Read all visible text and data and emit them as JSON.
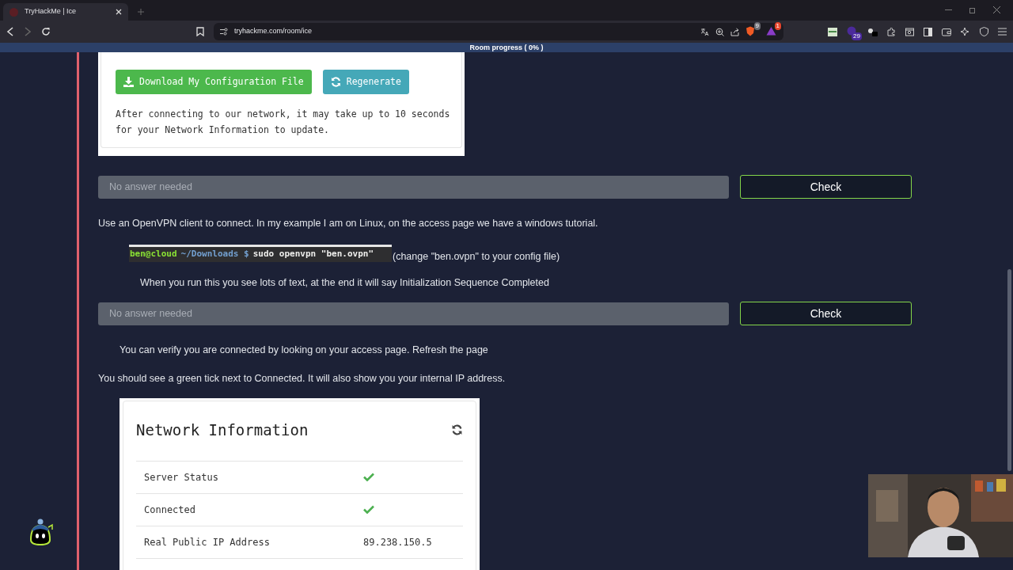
{
  "browser": {
    "tab_title": "TryHackMe | Ice",
    "url": "tryhackme.com/room/ice",
    "badges": [
      {
        "kind": "shield",
        "text": "9"
      },
      {
        "kind": "triangle",
        "text": "1"
      },
      {
        "kind": "extension",
        "text": "29"
      }
    ]
  },
  "progress_banner": "Room progress ( 0% )",
  "config_card": {
    "buttons": [
      {
        "kind": "download",
        "label": "Download My Configuration File"
      },
      {
        "kind": "regenerate",
        "label": "Regenerate"
      }
    ],
    "note": "After connecting to our network, it may take up to 10 seconds for your Network Information to update."
  },
  "blocks": [
    {
      "kind": "answer",
      "placeholder": "No answer needed",
      "button": "Check"
    },
    {
      "kind": "paragraph",
      "indented": false,
      "text": "Use an OpenVPN client to connect. In my example I am on Linux, on the access page we have a windows tutorial."
    },
    {
      "kind": "command",
      "user": "ben@cloud",
      "path": "~/Downloads $",
      "command": "sudo openvpn \"ben.ovpn\"",
      "note": "(change \"ben.ovpn\" to your config file)"
    },
    {
      "kind": "paragraph",
      "indented": true,
      "text": "When you run this you see lots of text, at the end it will say Initialization Sequence Completed"
    },
    {
      "kind": "answer",
      "placeholder": "No answer needed",
      "button": "Check"
    },
    {
      "kind": "paragraph",
      "indented": true,
      "text": "You can verify you are connected by looking on your access page. Refresh the page"
    },
    {
      "kind": "paragraph",
      "indented": false,
      "text": "You should see a green tick next to Connected. It will also show you your internal IP address."
    },
    {
      "kind": "network_card",
      "title": "Network Information",
      "rows": [
        {
          "label": "Server Status",
          "kind": "check"
        },
        {
          "label": "Connected",
          "kind": "check"
        },
        {
          "label": "Real Public IP Address",
          "kind": "text",
          "value": "89.238.150.5"
        }
      ]
    }
  ]
}
